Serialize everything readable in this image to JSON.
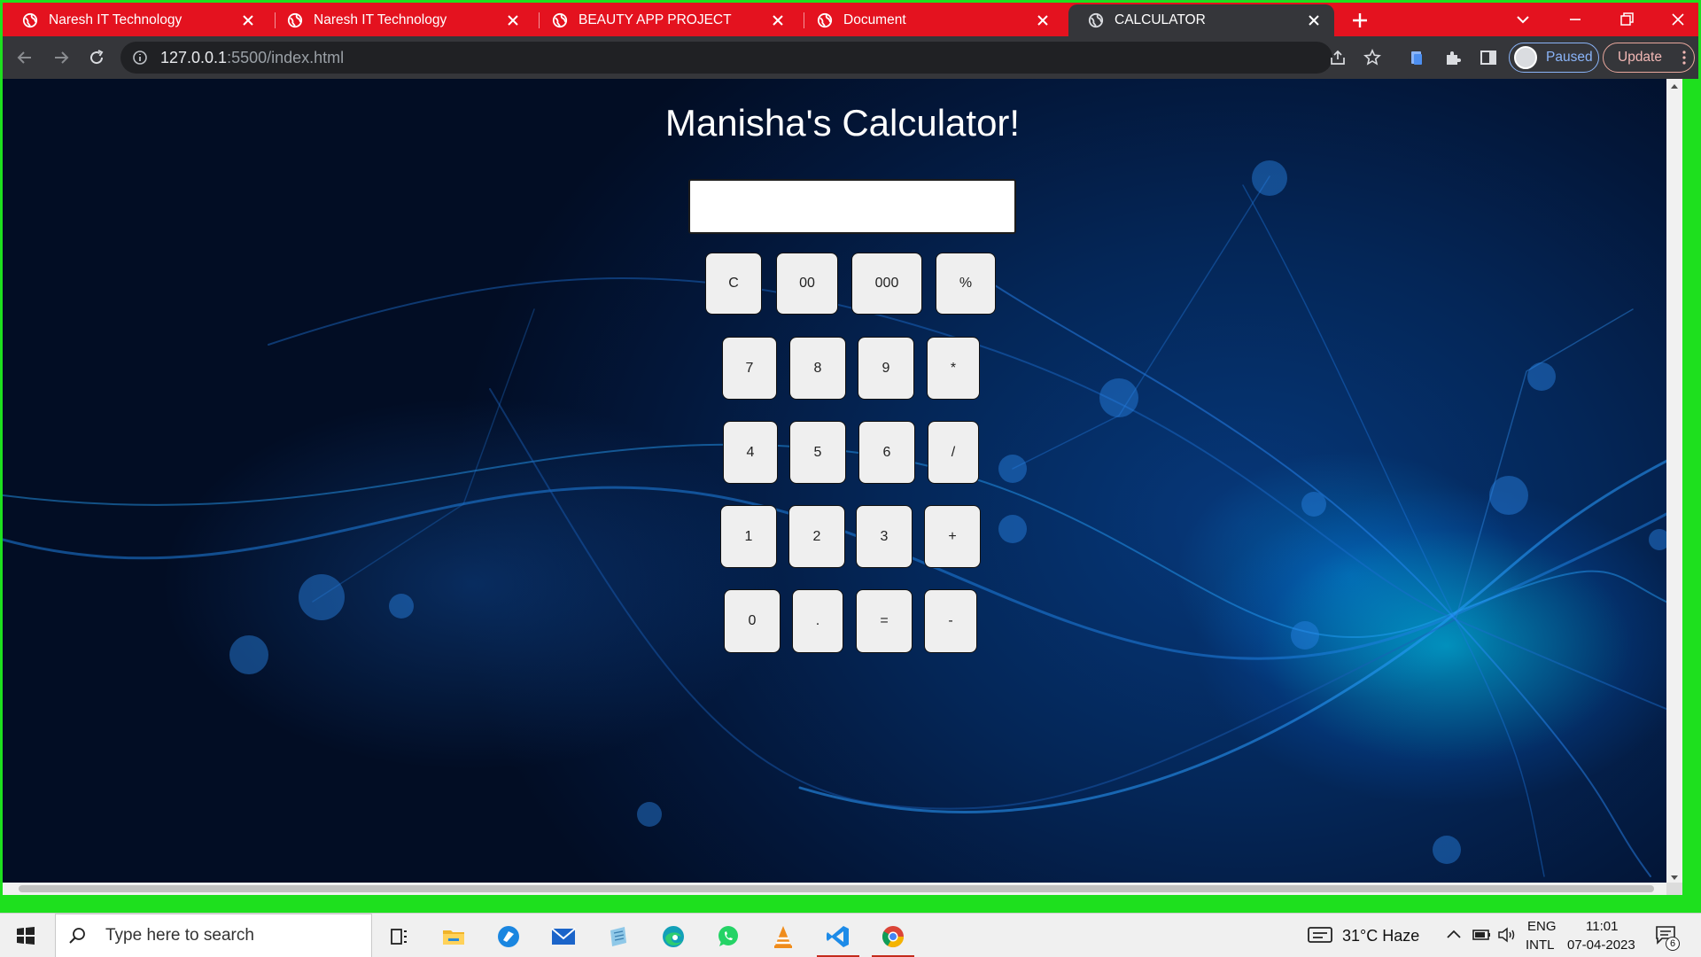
{
  "browser": {
    "tabs": [
      {
        "title": "Naresh IT Technology",
        "active": false
      },
      {
        "title": "Naresh IT Technology",
        "active": false
      },
      {
        "title": "BEAUTY APP PROJECT",
        "active": false
      },
      {
        "title": "Document",
        "active": false
      },
      {
        "title": "CALCULATOR",
        "active": true
      }
    ],
    "url_host": "127.0.0.1",
    "url_rest": ":5500/index.html",
    "profile_label": "Paused",
    "update_label": "Update",
    "colors": {
      "tabstrip": "#e4121f",
      "toolbar": "#35363a",
      "frame": "#1ee01e"
    }
  },
  "page": {
    "title": "Manisha's Calculator!",
    "display_value": "",
    "keys": [
      [
        "C",
        "00",
        "000",
        "%"
      ],
      [
        "7",
        "8",
        "9",
        "*"
      ],
      [
        "4",
        "5",
        "6",
        "/"
      ],
      [
        "1",
        "2",
        "3",
        "+"
      ],
      [
        "0",
        ".",
        "=",
        "-"
      ]
    ]
  },
  "taskbar": {
    "search_placeholder": "Type here to search",
    "weather": "31°C  Haze",
    "lang_top": "ENG",
    "lang_bottom": "INTL",
    "time": "11:01",
    "date": "07-04-2023",
    "notification_count": "6",
    "pinned_apps": [
      "task-view-icon",
      "file-explorer-icon",
      "browser-icon",
      "mail-icon",
      "notepad-icon",
      "edge-icon",
      "whatsapp-icon",
      "vlc-icon",
      "vscode-icon",
      "chrome-icon"
    ]
  }
}
